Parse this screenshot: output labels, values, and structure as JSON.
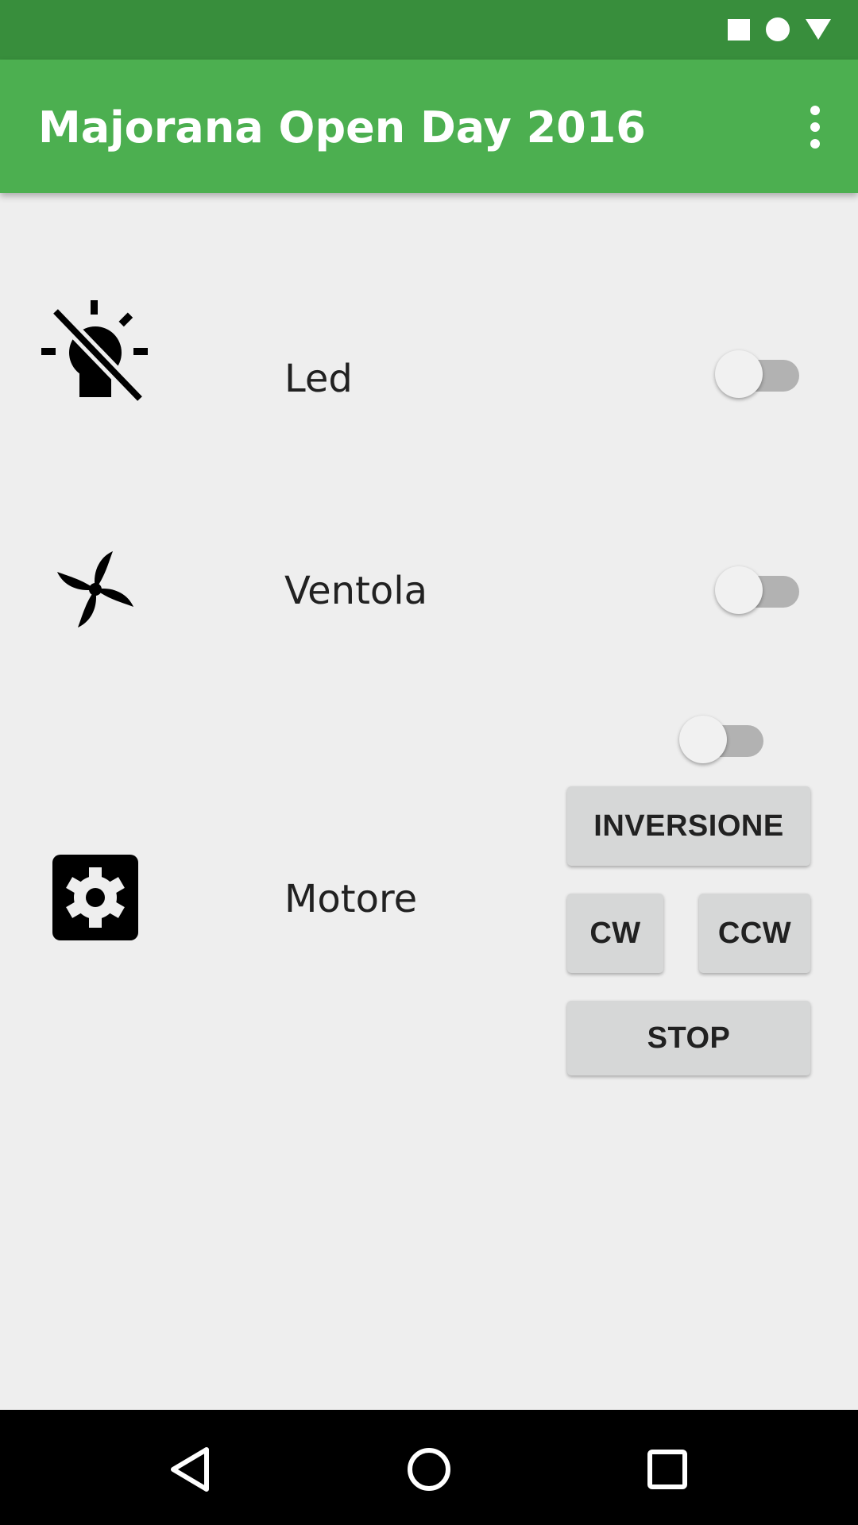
{
  "status_bar": {
    "icons": [
      "square-icon",
      "circle-icon",
      "triangle-icon"
    ]
  },
  "app_bar": {
    "title": "Majorana Open Day 2016",
    "menu_icon": "overflow-menu-icon",
    "color": "#4caf50"
  },
  "colors": {
    "status_bar": "#388e3c",
    "app_bar": "#4caf50",
    "background": "#eeeeee",
    "button": "#d6d7d7",
    "text": "#212121"
  },
  "rows": {
    "led": {
      "icon": "lightbulb-off-icon",
      "label": "Led",
      "switch_on": false
    },
    "fan": {
      "icon": "fan-icon",
      "label": "Ventola",
      "switch_on": false
    },
    "motor": {
      "icon": "settings-applications-icon",
      "label": "Motore",
      "switch_on": false,
      "buttons": {
        "reverse": "INVERSIONE",
        "cw": "CW",
        "ccw": "CCW",
        "stop": "STOP"
      }
    }
  },
  "nav_bar": {
    "back_icon": "back-triangle-icon",
    "home_icon": "home-circle-icon",
    "recents_icon": "recents-square-icon"
  }
}
